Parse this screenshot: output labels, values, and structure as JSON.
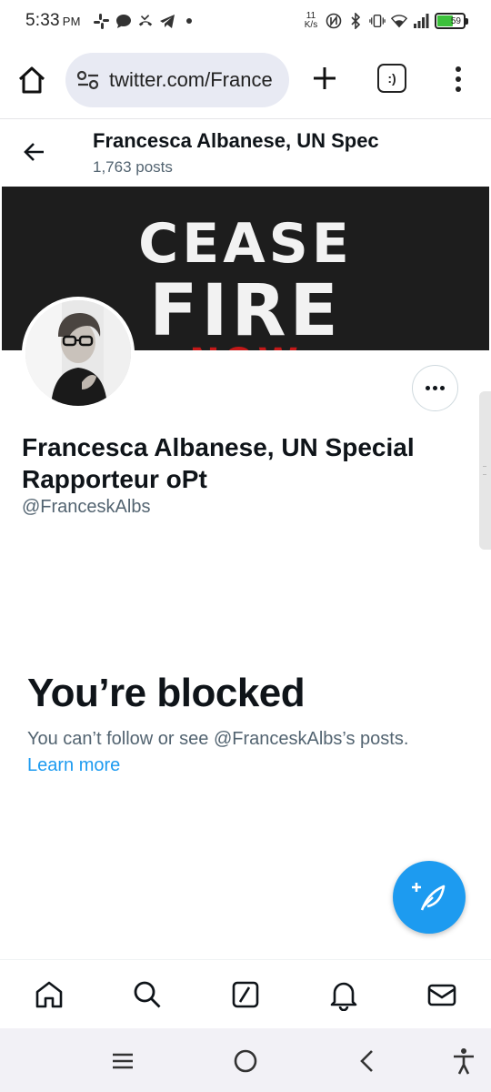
{
  "status_bar": {
    "time": "5:33",
    "ampm": "PM",
    "net_speed_value": "11",
    "net_speed_unit": "K/s",
    "battery_level": "59"
  },
  "browser": {
    "url": "twitter.com/France",
    "tabs_label": ":)"
  },
  "profile_header": {
    "name": "Francesca Albanese, UN Spec",
    "posts": "1,763 posts"
  },
  "banner": {
    "line1": "CEASE",
    "line2": "FIRE",
    "line3": "NOW"
  },
  "profile": {
    "name": "Francesca Albanese, UN Special Rapporteur oPt",
    "handle": "@FranceskAlbs"
  },
  "blocked": {
    "title": "You’re blocked",
    "description": "You can’t follow or see @FranceskAlbs’s posts.",
    "learn_more": "Learn more"
  },
  "colors": {
    "accent": "#1d9bf0",
    "secondary_text": "#536471",
    "battery_fill": "#3cc13b"
  },
  "bottom_nav": [
    "home-icon",
    "search-icon",
    "grok-icon",
    "notifications-icon",
    "messages-icon"
  ],
  "system_nav": [
    "recent-apps-icon",
    "home-circle-icon",
    "back-chevron-icon",
    "accessibility-icon"
  ]
}
